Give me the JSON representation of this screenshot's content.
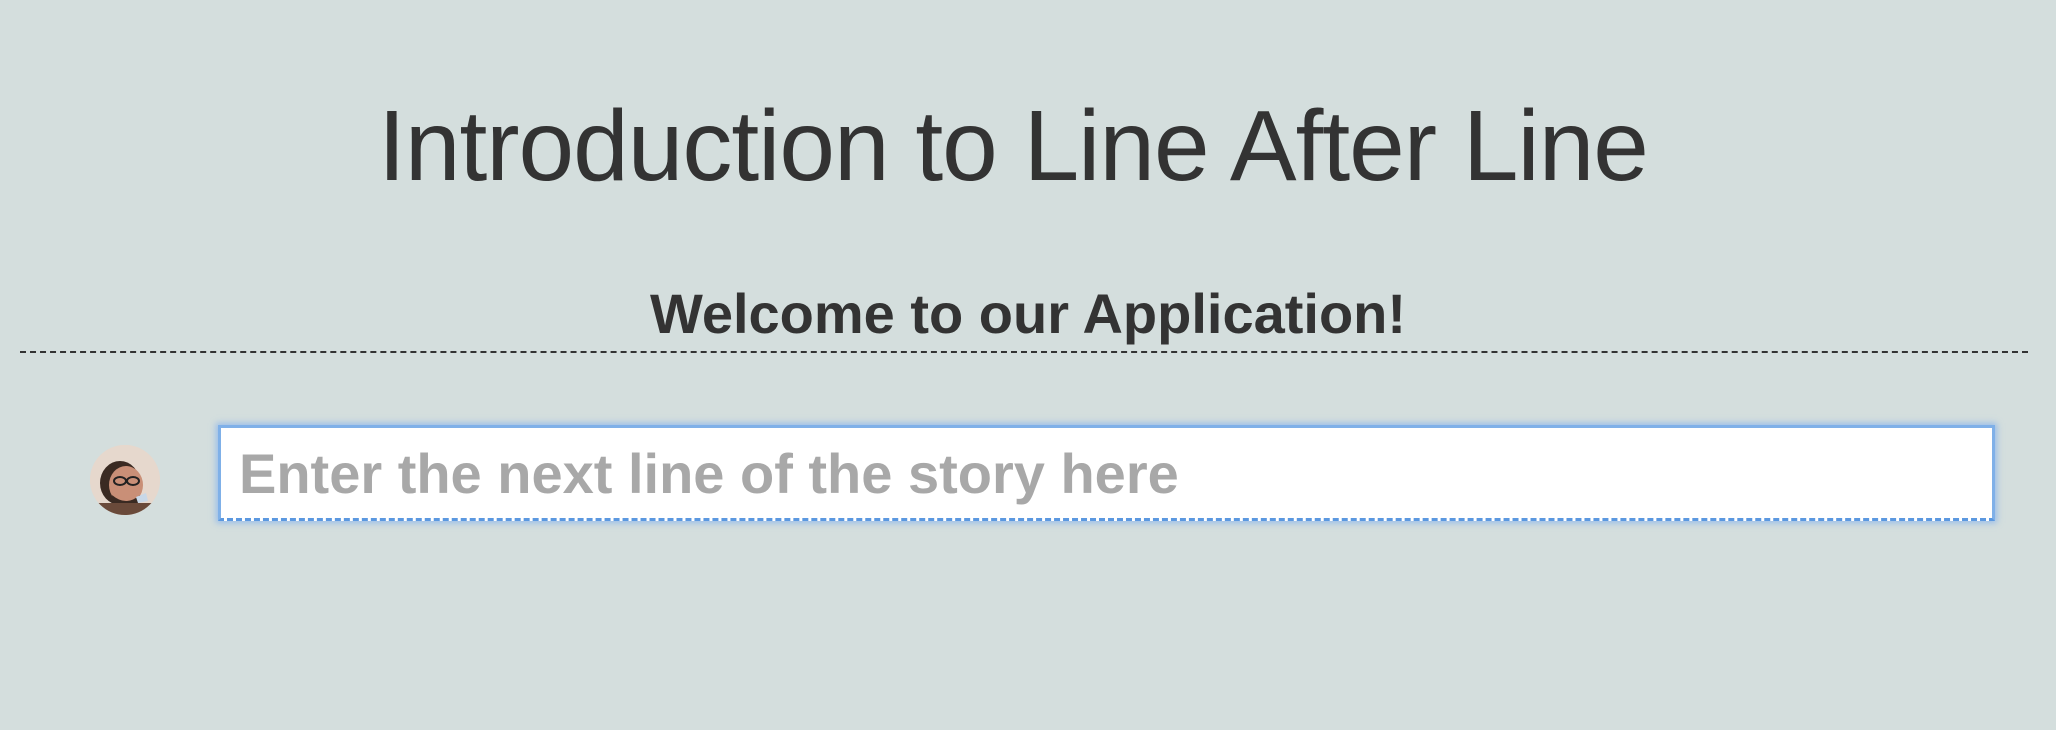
{
  "header": {
    "title": "Introduction to Line After Line",
    "welcome": "Welcome to our Application!"
  },
  "composer": {
    "avatar_icon": "user-avatar",
    "input_value": "",
    "input_placeholder": "Enter the next line of the story here"
  },
  "colors": {
    "background": "#d4dedd",
    "text": "#333333",
    "focus_ring": "#7fb0e8",
    "placeholder": "#a8a8a8"
  }
}
